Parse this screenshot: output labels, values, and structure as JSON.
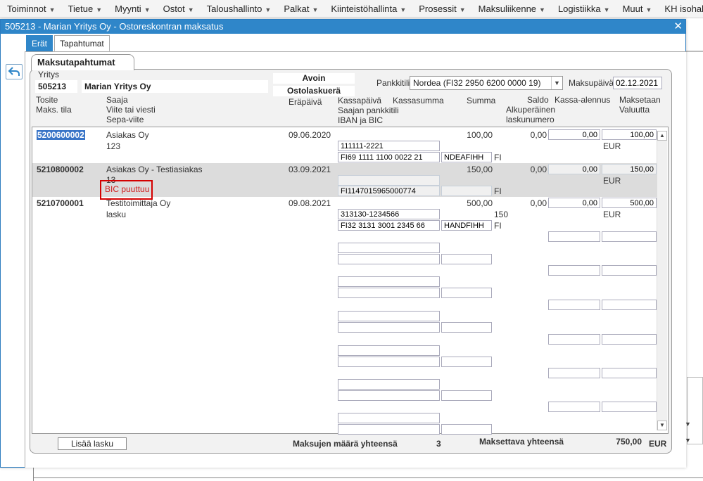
{
  "menu": [
    {
      "label": "Toiminnot"
    },
    {
      "label": "Tietue"
    },
    {
      "label": "Myynti"
    },
    {
      "label": "Ostot"
    },
    {
      "label": "Taloushallinto"
    },
    {
      "label": "Palkat"
    },
    {
      "label": "Kiinteistöhallinta"
    },
    {
      "label": "Prosessit"
    },
    {
      "label": "Maksuliikenne"
    },
    {
      "label": "Logistiikka"
    },
    {
      "label": "Muut"
    },
    {
      "label": "KH isohaku"
    }
  ],
  "dialog": {
    "title": "505213 - Marian Yritys Oy - Ostoreskontran maksatus",
    "close": "✕",
    "tabs": [
      {
        "label": "Erät"
      },
      {
        "label": "Tapahtumat"
      }
    ]
  },
  "panel": {
    "title": "Maksutapahtumat",
    "yritys_label": "Yritys",
    "yritys_code": "505213",
    "yritys_name": "Marian Yritys Oy",
    "status1": "Avoin",
    "status2": "Ostolaskuerä",
    "pankkitili_label": "Pankkitili",
    "pankkitili_value": "Nordea (FI32 2950 6200 0000 19)",
    "maksupaiva_label": "Maksupäivä",
    "maksupaiva_value": "02.12.2021"
  },
  "headers": {
    "tosite": "Tosite",
    "maks_tila": "Maks. tila",
    "saaja": "Saaja",
    "viite": "Viite tai viesti",
    "sepa": "Sepa-viite",
    "erapaiva": "Eräpäivä",
    "kassapaiva": "Kassapäivä",
    "kassasumma": "Kassasumma",
    "summa": "Summa",
    "saaja_pankkitili": "Saajan pankkitili",
    "iban_bic": "IBAN ja BIC",
    "saldo": "Saldo",
    "alkuperainen": "Alkuperäinen",
    "laskunumero": "laskunumero",
    "kassa_alennus": "Kassa-alennus",
    "maksetaan": "Maksetaan",
    "valuutta": "Valuutta"
  },
  "rows": [
    {
      "tosite": "5200600002",
      "saaja": "Asiakas Oy",
      "viite": "123",
      "erapaiva": "09.06.2020",
      "summa": "100,00",
      "saldo": "0,00",
      "kassa_alennus": "0,00",
      "maksetaan": "100,00",
      "valuutta": "EUR",
      "pankkitili": "111111-2221",
      "iban": "FI69 1111 1100 0022 21",
      "bic": "NDEAFIHH",
      "country": "FI",
      "laskunumero": ""
    },
    {
      "tosite": "5210800002",
      "saaja": "Asiakas Oy - Testiasiakas",
      "viite": "13",
      "status": "BIC puuttuu",
      "erapaiva": "03.09.2021",
      "summa": "150,00",
      "saldo": "0,00",
      "kassa_alennus": "0,00",
      "maksetaan": "150,00",
      "valuutta": "EUR",
      "pankkitili": "",
      "iban": "FI1147015965000774",
      "bic": "",
      "country": "FI",
      "laskunumero": ""
    },
    {
      "tosite": "5210700001",
      "saaja": "Testitoimittaja Oy",
      "viite": "lasku",
      "erapaiva": "09.08.2021",
      "summa": "500,00",
      "saldo": "0,00",
      "kassa_alennus": "0,00",
      "maksetaan": "500,00",
      "valuutta": "EUR",
      "pankkitili": "313130-1234566",
      "iban": "FI32 3131 3001 2345 66",
      "bic": "HANDFIHH",
      "country": "FI",
      "laskunumero": "150"
    }
  ],
  "footer": {
    "add_button": "Lisää lasku",
    "count_label": "Maksujen määrä yhteensä",
    "count_value": "3",
    "total_label": "Maksettava yhteensä",
    "total_value": "750,00",
    "currency": "EUR"
  },
  "icons": {
    "back": "back-arrow-icon",
    "dropdown": "chevron-down-icon"
  }
}
